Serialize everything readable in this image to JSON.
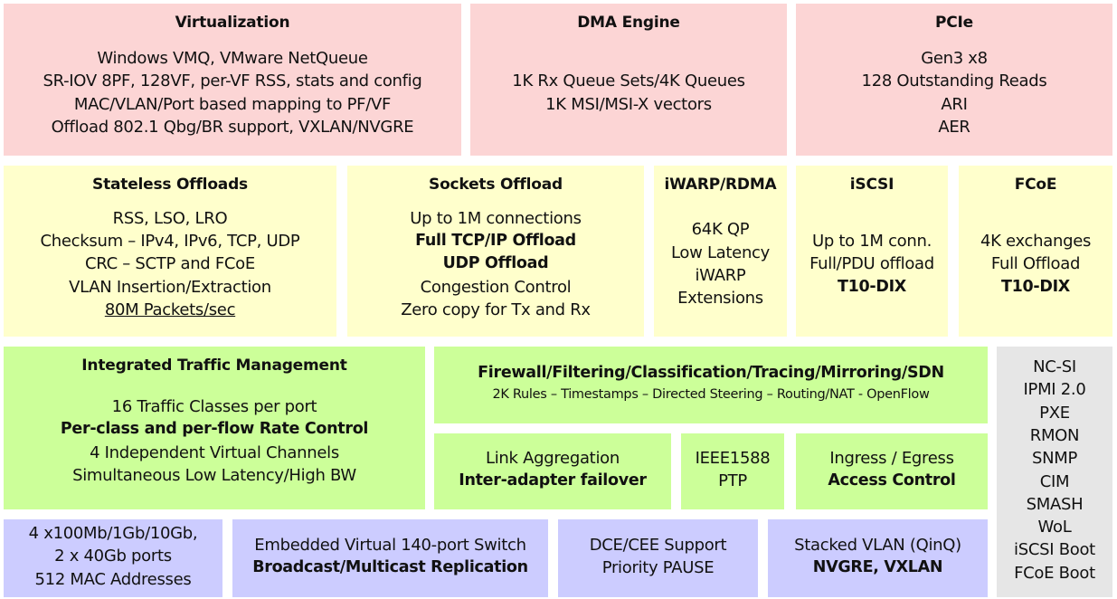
{
  "colors": {
    "pink": "#fcd5d5",
    "yellow": "#ffffcc",
    "green": "#ccff99",
    "purple": "#ccccff",
    "gray": "#e6e6e6"
  },
  "boxes": [
    {
      "id": "virtualization",
      "color": "pink",
      "title": "Virtualization",
      "lines": [
        {
          "t": "Windows VMQ, VMware NetQueue"
        },
        {
          "t": "SR-IOV 8PF, 128VF, per-VF RSS, stats and config"
        },
        {
          "t": "MAC/VLAN/Port based mapping to PF/VF"
        },
        {
          "t": "Offload 802.1 Qbg/BR support, VXLAN/NVGRE"
        }
      ]
    },
    {
      "id": "dma-engine",
      "color": "pink",
      "title": "DMA Engine",
      "lines": [
        {
          "t": "1K Rx Queue Sets/4K Queues"
        },
        {
          "t": "1K MSI/MSI-X vectors"
        }
      ]
    },
    {
      "id": "pcie",
      "color": "pink",
      "title": "PCIe",
      "lines": [
        {
          "t": "Gen3 x8"
        },
        {
          "t": "128 Outstanding Reads"
        },
        {
          "t": "ARI"
        },
        {
          "t": "AER"
        }
      ]
    },
    {
      "id": "stateless-offloads",
      "color": "yellow",
      "title": "Stateless Offloads",
      "lines": [
        {
          "t": "RSS, LSO, LRO"
        },
        {
          "t": "Checksum – IPv4, IPv6, TCP, UDP"
        },
        {
          "t": "CRC – SCTP and FCoE"
        },
        {
          "t": "VLAN Insertion/Extraction"
        },
        {
          "t": "80M Packets/sec",
          "u": true
        }
      ]
    },
    {
      "id": "sockets-offload",
      "color": "yellow",
      "title": "Sockets Offload",
      "lines": [
        {
          "t": "Up to 1M connections"
        },
        {
          "t": "Full TCP/IP Offload",
          "b": true
        },
        {
          "t": "UDP Offload",
          "b": true
        },
        {
          "t": "Congestion Control"
        },
        {
          "t": "Zero copy for Tx and Rx"
        }
      ]
    },
    {
      "id": "iwarp-rdma",
      "color": "yellow",
      "title": "iWARP/RDMA",
      "lines": [
        {
          "t": "64K QP"
        },
        {
          "t": "Low Latency"
        },
        {
          "t": "iWARP"
        },
        {
          "t": "Extensions"
        }
      ]
    },
    {
      "id": "iscsi",
      "color": "yellow",
      "title": "iSCSI",
      "lines": [
        {
          "t": "Up to 1M conn."
        },
        {
          "t": "Full/PDU offload"
        },
        {
          "t": "T10-DIX",
          "b": true
        }
      ]
    },
    {
      "id": "fcoe",
      "color": "yellow",
      "title": "FCoE",
      "lines": [
        {
          "t": "4K exchanges"
        },
        {
          "t": "Full Offload"
        },
        {
          "t": "T10-DIX",
          "b": true
        }
      ]
    },
    {
      "id": "integrated-traffic-management",
      "color": "green",
      "title": "Integrated Traffic Management",
      "lines": [
        {
          "t": "16 Traffic Classes per port"
        },
        {
          "t": "Per-class and per-flow Rate Control",
          "b": true
        },
        {
          "t": "4 Independent Virtual Channels"
        },
        {
          "t": "Simultaneous Low Latency/High BW"
        }
      ]
    },
    {
      "id": "firewall-filtering",
      "color": "green",
      "title": "",
      "lines": [
        {
          "t": "Firewall/Filtering/Classification/Tracing/Mirroring/SDN",
          "b": true
        },
        {
          "t": "2K Rules – Timestamps – Directed Steering – Routing/NAT - OpenFlow",
          "s": true
        }
      ]
    },
    {
      "id": "link-aggregation",
      "color": "green",
      "title": "",
      "lines": [
        {
          "t": "Link Aggregation"
        },
        {
          "t": "Inter-adapter failover",
          "b": true
        }
      ]
    },
    {
      "id": "ieee1588",
      "color": "green",
      "title": "",
      "lines": [
        {
          "t": "IEEE1588"
        },
        {
          "t": "PTP"
        }
      ]
    },
    {
      "id": "ingress-egress",
      "color": "green",
      "title": "",
      "lines": [
        {
          "t": "Ingress / Egress"
        },
        {
          "t": "Access Control",
          "b": true
        }
      ]
    },
    {
      "id": "management",
      "color": "gray",
      "title": "",
      "lines": [
        {
          "t": "NC-SI"
        },
        {
          "t": "IPMI 2.0"
        },
        {
          "t": "PXE"
        },
        {
          "t": "RMON"
        },
        {
          "t": "SNMP"
        },
        {
          "t": "CIM"
        },
        {
          "t": "SMASH"
        },
        {
          "t": "WoL"
        },
        {
          "t": "iSCSI Boot"
        },
        {
          "t": "FCoE Boot"
        }
      ]
    },
    {
      "id": "ports",
      "color": "purple",
      "title": "",
      "lines": [
        {
          "t": "4 x100Mb/1Gb/10Gb,"
        },
        {
          "t": "2 x 40Gb ports"
        },
        {
          "t": "512 MAC Addresses"
        }
      ]
    },
    {
      "id": "embedded-switch",
      "color": "purple",
      "title": "",
      "lines": [
        {
          "t": "Embedded Virtual 140-port Switch"
        },
        {
          "t": "Broadcast/Multicast Replication",
          "b": true
        }
      ]
    },
    {
      "id": "dce-cee",
      "color": "purple",
      "title": "",
      "lines": [
        {
          "t": "DCE/CEE Support"
        },
        {
          "t": "Priority PAUSE"
        }
      ]
    },
    {
      "id": "stacked-vlan",
      "color": "purple",
      "title": "",
      "lines": [
        {
          "t": "Stacked VLAN (QinQ)"
        },
        {
          "t": "NVGRE, VXLAN",
          "b": true
        }
      ]
    }
  ]
}
